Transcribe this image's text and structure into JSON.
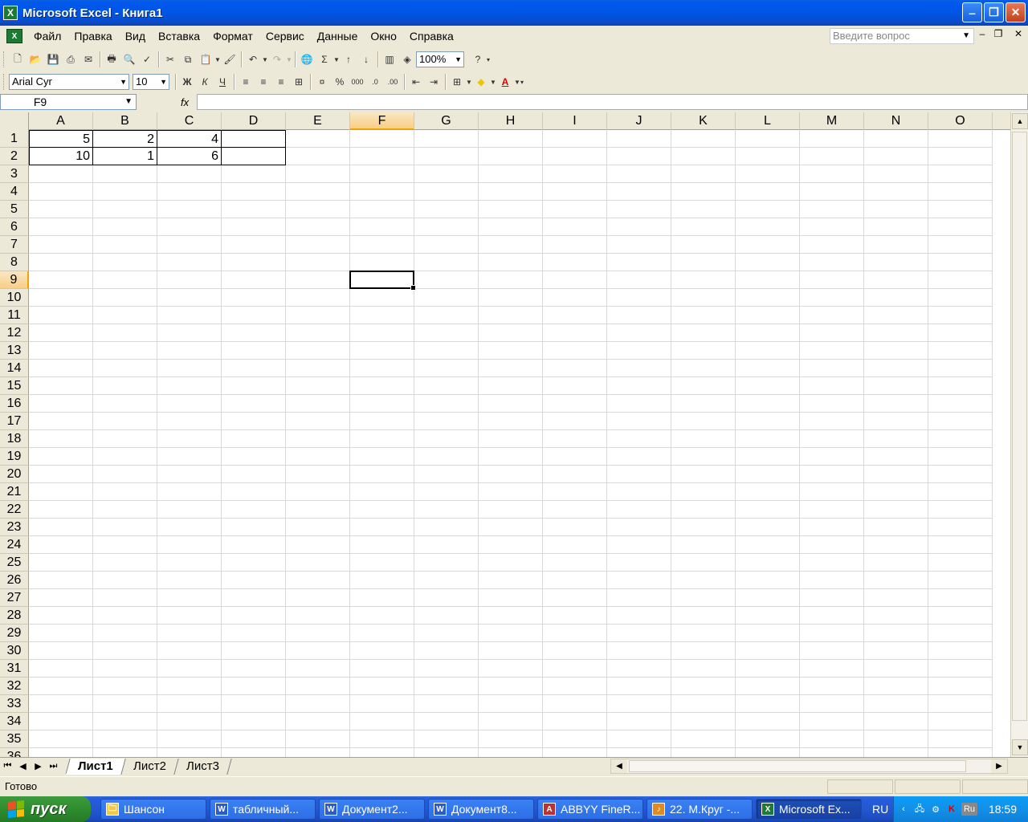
{
  "window": {
    "title": "Microsoft Excel - Книга1"
  },
  "menu": {
    "items": [
      "Файл",
      "Правка",
      "Вид",
      "Вставка",
      "Формат",
      "Сервис",
      "Данные",
      "Окно",
      "Справка"
    ],
    "help_placeholder": "Введите вопрос"
  },
  "toolbar": {
    "zoom": "100%"
  },
  "format_toolbar": {
    "font": "Arial Cyr",
    "size": "10",
    "bold": "Ж",
    "italic": "К",
    "underline": "Ч"
  },
  "formula": {
    "name_box": "F9",
    "fx": "fx",
    "content": ""
  },
  "sheet": {
    "columns": [
      "A",
      "B",
      "C",
      "D",
      "E",
      "F",
      "G",
      "H",
      "I",
      "J",
      "K",
      "L",
      "M",
      "N",
      "O"
    ],
    "selected_column": "F",
    "selected_row": 9,
    "active_cell": "F9",
    "row_count": 36,
    "data": [
      [
        "5",
        "2",
        "4",
        ""
      ],
      [
        "10",
        "1",
        "6",
        ""
      ]
    ],
    "tabs": [
      "Лист1",
      "Лист2",
      "Лист3"
    ],
    "active_tab": "Лист1"
  },
  "status": {
    "text": "Готово"
  },
  "taskbar": {
    "start_label": "пуск",
    "buttons": [
      {
        "label": "Шансон",
        "icon": "folder-icon"
      },
      {
        "label": "табличный...",
        "icon": "word-icon"
      },
      {
        "label": "Документ2...",
        "icon": "word-icon"
      },
      {
        "label": "Документ8...",
        "icon": "word-icon"
      },
      {
        "label": "ABBYY FineR...",
        "icon": "abbyy-icon"
      },
      {
        "label": "22. М.Круг -...",
        "icon": "music-icon"
      },
      {
        "label": "Microsoft Ex...",
        "icon": "excel-icon",
        "active": true
      }
    ],
    "language": "RU",
    "tray_language": "Ru",
    "clock": "18:59"
  },
  "colors": {
    "title_bar": "#0055e5",
    "taskbar": "#245edb",
    "start": "#2f8c2f",
    "selection": "#f8cf85"
  }
}
